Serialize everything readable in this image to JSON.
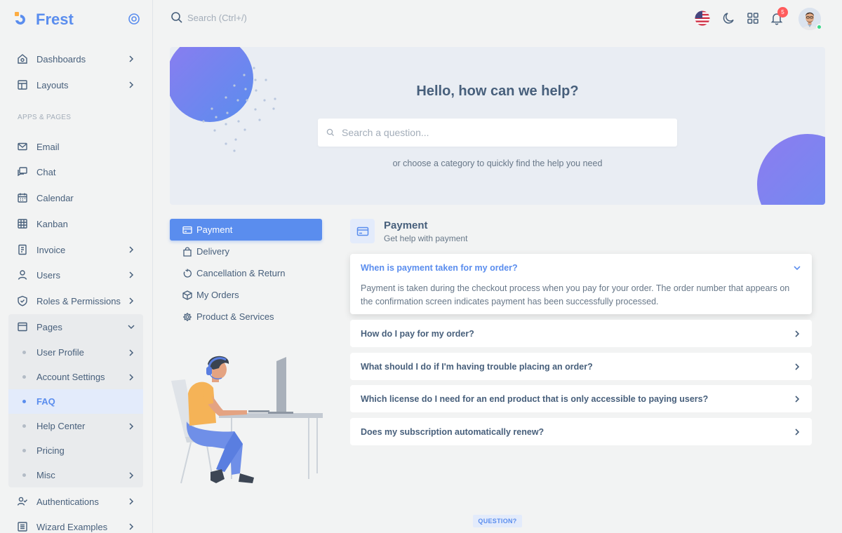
{
  "brand": {
    "name": "Frest"
  },
  "sidebar": {
    "items_top": [
      {
        "label": "Dashboards",
        "icon": "home-icon"
      },
      {
        "label": "Layouts",
        "icon": "layout-icon"
      }
    ],
    "section_label": "APPS & PAGES",
    "apps": [
      {
        "label": "Email",
        "icon": "mail-icon"
      },
      {
        "label": "Chat",
        "icon": "chat-icon"
      },
      {
        "label": "Calendar",
        "icon": "calendar-icon"
      },
      {
        "label": "Kanban",
        "icon": "grid-icon"
      },
      {
        "label": "Invoice",
        "icon": "invoice-icon"
      },
      {
        "label": "Users",
        "icon": "user-icon"
      },
      {
        "label": "Roles & Permissions",
        "icon": "shield-icon"
      },
      {
        "label": "Pages",
        "icon": "page-icon"
      }
    ],
    "pages_sub": [
      {
        "label": "User Profile"
      },
      {
        "label": "Account Settings"
      },
      {
        "label": "FAQ",
        "active": true
      },
      {
        "label": "Help Center"
      },
      {
        "label": "Pricing"
      },
      {
        "label": "Misc"
      }
    ],
    "items_bottom": [
      {
        "label": "Authentications",
        "icon": "user-check-icon"
      },
      {
        "label": "Wizard Examples",
        "icon": "wizard-icon"
      }
    ]
  },
  "topbar": {
    "search_placeholder": "Search (Ctrl+/)",
    "notification_count": "5"
  },
  "hero": {
    "title": "Hello, how can we help?",
    "search_placeholder": "Search a question...",
    "subtitle": "or choose a category to quickly find the help you need"
  },
  "categories": [
    {
      "label": "Payment",
      "icon": "credit-card-icon",
      "active": true
    },
    {
      "label": "Delivery",
      "icon": "shopping-bag-icon"
    },
    {
      "label": "Cancellation & Return",
      "icon": "refresh-icon"
    },
    {
      "label": "My Orders",
      "icon": "box-icon"
    },
    {
      "label": "Product & Services",
      "icon": "settings-icon"
    }
  ],
  "section": {
    "title": "Payment",
    "subtitle": "Get help with payment"
  },
  "faqs": [
    {
      "question": "When is payment taken for my order?",
      "answer": "Payment is taken during the checkout process when you pay for your order. The order number that appears on the confirmation screen indicates payment has been successfully processed.",
      "open": true
    },
    {
      "question": "How do I pay for my order?"
    },
    {
      "question": "What should I do if I'm having trouble placing an order?"
    },
    {
      "question": "Which license do I need for an end product that is only accessible to paying users?"
    },
    {
      "question": "Does my subscription automatically renew?"
    }
  ],
  "footer_badge": "QUESTION?",
  "colors": {
    "primary": "#5a8dee",
    "text": "#475f7b",
    "muted": "#677788",
    "danger": "#ff5b5c",
    "success": "#39da8a"
  }
}
